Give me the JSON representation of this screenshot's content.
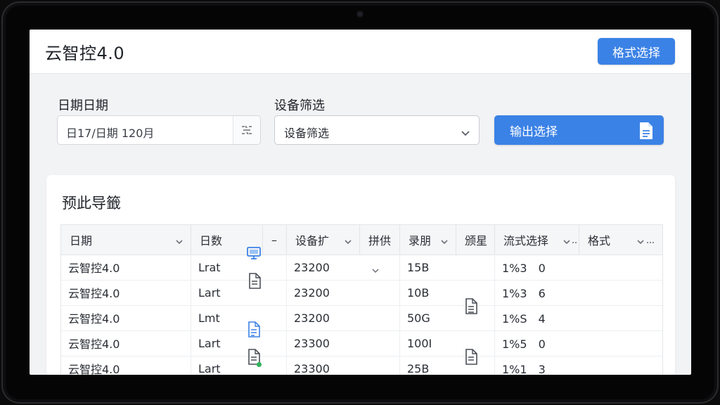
{
  "app": {
    "title": "云智控4.0",
    "format_button": "格式选择"
  },
  "filters": {
    "date_label": "日期日期",
    "date_value": "日17/日期 120月",
    "device_label": "设备筛选",
    "device_value": "设备筛选",
    "export_button": "输出选择"
  },
  "preview": {
    "title": "预此导籤",
    "columns": [
      "日期",
      "日数",
      "–",
      "设备扩",
      "拼供",
      "录朋",
      "颁星",
      "流式选择",
      "格式"
    ],
    "rows": [
      [
        "云智控4.0",
        "Lrat",
        "",
        "23200",
        "",
        "15B",
        "",
        "1%3　0",
        ""
      ],
      [
        "云智控4.0",
        "Lart",
        "",
        "23200",
        "",
        "10B",
        "",
        "1%3　6",
        ""
      ],
      [
        "云智控4.0",
        "Lmt",
        "",
        "23200",
        "",
        "50G",
        "",
        "1%S　4",
        ""
      ],
      [
        "云智控4.0",
        "Lart",
        "",
        "23300",
        "",
        "100I",
        "",
        "1%5　0",
        ""
      ],
      [
        "云智控4.0",
        "Lart",
        "",
        "23300",
        "",
        "25B",
        "",
        "1%1　3",
        ""
      ]
    ]
  },
  "colors": {
    "accent": "#3b82e6",
    "icon_blue": "#3b82e6",
    "icon_gray": "#4a4f57",
    "status_green": "#30b35a"
  },
  "icons": [
    "filter-icon",
    "chevron-down-icon",
    "document-icon",
    "monitor-icon"
  ]
}
